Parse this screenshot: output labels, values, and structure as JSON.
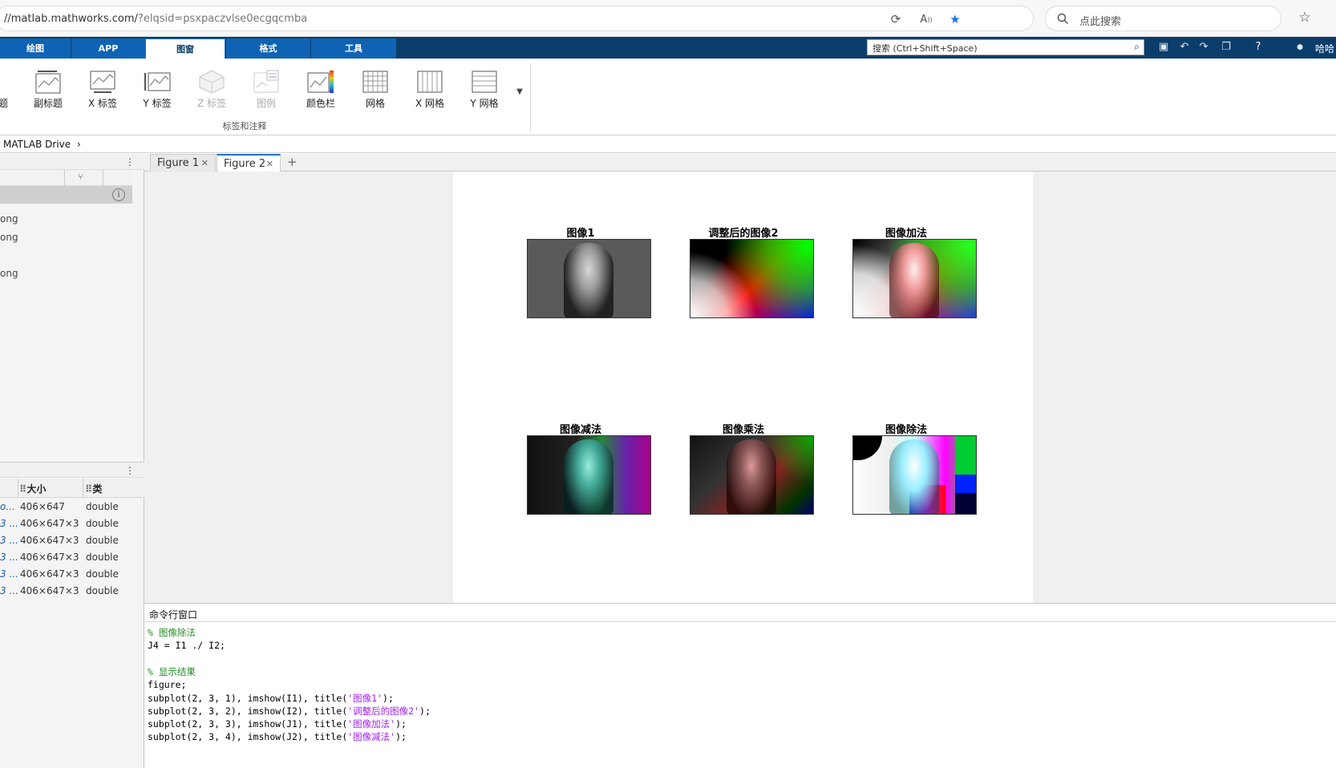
{
  "browser": {
    "url_host": "//matlab.mathworks.com/",
    "url_query": "?elqsid=psxpaczvlse0ecgqcmba",
    "search_placeholder": "点此搜索"
  },
  "toolstrip": {
    "tabs": [
      "绘图",
      "APP",
      "图窗",
      "格式",
      "工具"
    ],
    "search_placeholder": "搜索 (Ctrl+Shift+Space)",
    "user": "哈哈"
  },
  "ribbon": {
    "buttons": [
      {
        "label": "题",
        "enabled": true
      },
      {
        "label": "副标题",
        "enabled": true
      },
      {
        "label": "X 标签",
        "enabled": true
      },
      {
        "label": "Y 标签",
        "enabled": true
      },
      {
        "label": "Z 标签",
        "enabled": false
      },
      {
        "label": "图例",
        "enabled": false
      },
      {
        "label": "颜色栏",
        "enabled": true
      },
      {
        "label": "网格",
        "enabled": true
      },
      {
        "label": "X 网格",
        "enabled": true
      },
      {
        "label": "Y 网格",
        "enabled": true
      }
    ],
    "group_label": "标签和注释"
  },
  "address_bar": {
    "path": "MATLAB Drive",
    "sep": "›"
  },
  "file_browser": {
    "files": [
      "ong",
      "ong",
      "ong"
    ]
  },
  "workspace": {
    "columns": {
      "size": "大小",
      "class": "类"
    },
    "rows": [
      {
        "name": "o...",
        "size": "406×647",
        "class": "double"
      },
      {
        "name": "3 ...",
        "size": "406×647×3",
        "class": "double"
      },
      {
        "name": "3 ...",
        "size": "406×647×3",
        "class": "double"
      },
      {
        "name": "3 ...",
        "size": "406×647×3",
        "class": "double"
      },
      {
        "name": "3 ...",
        "size": "406×647×3",
        "class": "double"
      },
      {
        "name": "3 ...",
        "size": "406×647×3",
        "class": "double"
      }
    ]
  },
  "figure_tabs": [
    "Figure 1",
    "Figure 2"
  ],
  "subplots": [
    {
      "title": "图像1",
      "style": "gray"
    },
    {
      "title": "调整后的图像2",
      "style": "gradient"
    },
    {
      "title": "图像加法",
      "style": "add"
    },
    {
      "title": "图像减法",
      "style": "sub"
    },
    {
      "title": "图像乘法",
      "style": "mul"
    },
    {
      "title": "图像除法",
      "style": "div"
    }
  ],
  "command_window": {
    "title": "命令行窗口",
    "lines": [
      {
        "comment": "% 图像除法"
      },
      {
        "code": "J4 = I1 ./ I2;"
      },
      {
        "blank": true
      },
      {
        "comment": "% 显示结果"
      },
      {
        "code": "figure;"
      },
      {
        "code": "subplot(2, 3, 1), imshow(I1), title(",
        "str": "'图像1'",
        "tail": ");"
      },
      {
        "code": "subplot(2, 3, 2), imshow(I2), title(",
        "str": "'调整后的图像2'",
        "tail": ");"
      },
      {
        "code": "subplot(2, 3, 3), imshow(J1), title(",
        "str": "'图像加法'",
        "tail": ");"
      },
      {
        "code": "subplot(2, 3, 4), imshow(J2), title(",
        "str": "'图像减法'",
        "tail": ");"
      }
    ]
  },
  "colors": {
    "toolstrip_bg": "#0b3d6b",
    "tab_bg": "#0e63b4",
    "comment": "#228b22",
    "string": "#a020f0"
  }
}
